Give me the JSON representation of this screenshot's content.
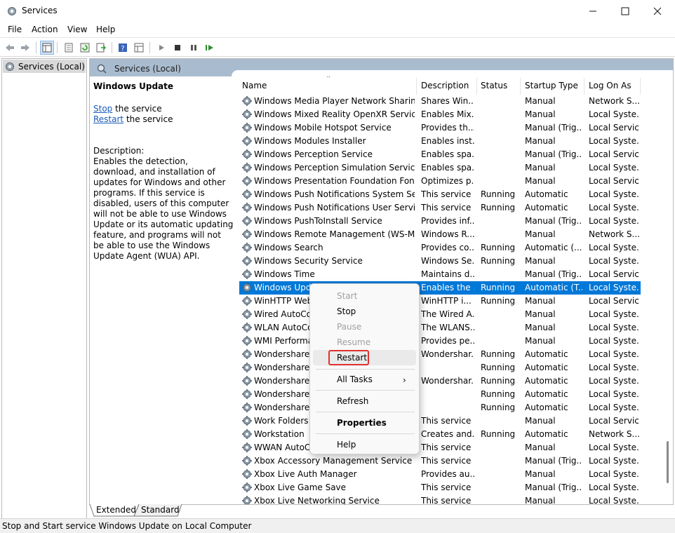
{
  "window": {
    "title": "Services"
  },
  "menubar": [
    "File",
    "Action",
    "View",
    "Help"
  ],
  "tree": {
    "selected_label": "Services (Local)"
  },
  "panel": {
    "header": "Services (Local)",
    "service_name": "Windows Update",
    "stop_link": "Stop",
    "stop_suffix": " the service",
    "restart_link": "Restart",
    "restart_suffix": " the service",
    "description_label": "Description:",
    "description_text": "Enables the detection, download, and installation of updates for Windows and other programs. If this service is disabled, users of this computer will not be able to use Windows Update or its automatic updating feature, and programs will not be able to use the Windows Update Agent (WUA) API."
  },
  "grid": {
    "columns": [
      "Name",
      "Description",
      "Status",
      "Startup Type",
      "Log On As"
    ],
    "rows": [
      [
        "Windows Media Player Network Sharing S...",
        "Shares Win...",
        "",
        "Manual",
        "Network S..."
      ],
      [
        "Windows Mixed Reality OpenXR Service",
        "Enables Mix...",
        "",
        "Manual",
        "Local Syste..."
      ],
      [
        "Windows Mobile Hotspot Service",
        "Provides th...",
        "",
        "Manual (Trig...",
        "Local Service"
      ],
      [
        "Windows Modules Installer",
        "Enables inst...",
        "",
        "Manual",
        "Local Syste..."
      ],
      [
        "Windows Perception Service",
        "Enables spa...",
        "",
        "Manual (Trig...",
        "Local Service"
      ],
      [
        "Windows Perception Simulation Service",
        "Enables spa...",
        "",
        "Manual",
        "Local Syste..."
      ],
      [
        "Windows Presentation Foundation Font C...",
        "Optimizes p...",
        "",
        "Manual",
        "Local Service"
      ],
      [
        "Windows Push Notifications System Service",
        "This service ...",
        "Running",
        "Automatic",
        "Local Syste..."
      ],
      [
        "Windows Push Notifications User Service_...",
        "This service ...",
        "Running",
        "Automatic",
        "Local Syste..."
      ],
      [
        "Windows PushToInstall Service",
        "Provides inf...",
        "",
        "Manual (Trig...",
        "Local Syste..."
      ],
      [
        "Windows Remote Management (WS-Man...",
        "Windows R...",
        "",
        "Manual",
        "Network S..."
      ],
      [
        "Windows Search",
        "Provides co...",
        "Running",
        "Automatic (...",
        "Local Syste..."
      ],
      [
        "Windows Security Service",
        "Windows Se...",
        "Running",
        "Manual",
        "Local Syste..."
      ],
      [
        "Windows Time",
        "Maintains d...",
        "",
        "Manual (Trig...",
        "Local Service"
      ],
      [
        "Windows Upda",
        "Enables the ...",
        "Running",
        "Automatic (T...",
        "Local Syste..."
      ],
      [
        "WinHTTP Web",
        "WinHTTP i...",
        "Running",
        "Manual",
        "Local Service"
      ],
      [
        "Wired AutoCo",
        "The Wired A...",
        "",
        "Manual",
        "Local Syste..."
      ],
      [
        "WLAN AutoCo",
        "The WLANS...",
        "",
        "Manual",
        "Local Syste..."
      ],
      [
        "WMI Performar",
        "Provides pe...",
        "",
        "Manual",
        "Local Syste..."
      ],
      [
        "Wondershare A",
        "Wondershar...",
        "Running",
        "Automatic",
        "Local Syste..."
      ],
      [
        "Wondershare D",
        "",
        "Running",
        "Automatic",
        "Local Syste..."
      ],
      [
        "Wondershare Ir",
        "Wondershar...",
        "Running",
        "Automatic",
        "Local Syste..."
      ],
      [
        "Wondershare w",
        "",
        "Running",
        "Automatic",
        "Local Syste..."
      ],
      [
        "Wondershare W",
        "",
        "Running",
        "Automatic",
        "Local Syste..."
      ],
      [
        "Work Folders",
        "This service ...",
        "",
        "Manual",
        "Local Service"
      ],
      [
        "Workstation",
        "Creates and...",
        "Running",
        "Automatic",
        "Network S..."
      ],
      [
        "WWAN AutoCo",
        "This service ...",
        "",
        "Manual",
        "Local Syste..."
      ],
      [
        "Xbox Accessory Management Service",
        "This service ...",
        "",
        "Manual (Trig...",
        "Local Syste..."
      ],
      [
        "Xbox Live Auth Manager",
        "Provides au...",
        "",
        "Manual",
        "Local Syste..."
      ],
      [
        "Xbox Live Game Save",
        "This service ...",
        "",
        "Manual (Trig...",
        "Local Syste..."
      ],
      [
        "Xbox Live Networking Service",
        "This service ...",
        "",
        "Manual",
        "Local Syste..."
      ]
    ],
    "selected_row": 14
  },
  "context_menu": {
    "start": "Start",
    "stop": "Stop",
    "pause": "Pause",
    "resume": "Resume",
    "restart": "Restart",
    "all_tasks": "All Tasks",
    "refresh": "Refresh",
    "properties": "Properties",
    "help": "Help"
  },
  "tabs": [
    "Extended",
    "Standard"
  ],
  "status": "Stop and Start service Windows Update on Local Computer",
  "colors": {
    "selection": "#0078d7",
    "header": "#a9bccf",
    "highlight_box": "#e03030"
  }
}
